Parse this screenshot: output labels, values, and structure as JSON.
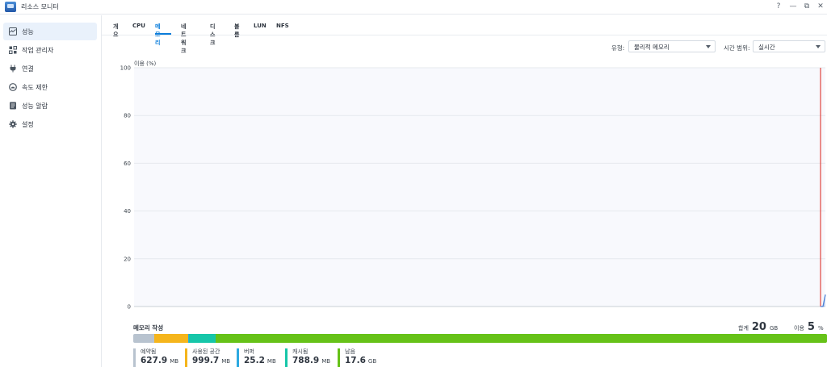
{
  "window": {
    "title": "리소스 모니터",
    "controls": {
      "help": "?",
      "minimize": "—",
      "restore": "⧉",
      "close": "✕"
    }
  },
  "sidebar": {
    "items": [
      {
        "label": "성능",
        "icon": "performance-icon",
        "active": true
      },
      {
        "label": "작업 관리자",
        "icon": "task-manager-icon"
      },
      {
        "label": "연결",
        "icon": "plug-icon"
      },
      {
        "label": "속도 제한",
        "icon": "speed-limit-icon"
      },
      {
        "label": "성능 알람",
        "icon": "alarm-icon"
      },
      {
        "label": "설정",
        "icon": "gear-icon"
      }
    ]
  },
  "tabs": [
    {
      "label": "개요"
    },
    {
      "label": "CPU"
    },
    {
      "label": "메모리",
      "active": true
    },
    {
      "label": "네트워크"
    },
    {
      "label": "디스크"
    },
    {
      "label": "볼륨"
    },
    {
      "label": "LUN"
    },
    {
      "label": "NFS"
    }
  ],
  "filters": {
    "type_label": "유형:",
    "type_value": "물리적 메모리",
    "range_label": "시간 범위:",
    "range_value": "실시간"
  },
  "chart_data": {
    "type": "line",
    "ylabel": "이용 (%)",
    "ylim": [
      0,
      100
    ],
    "yticks": [
      "100",
      "80",
      "60",
      "40",
      "20",
      "0"
    ],
    "grid": true,
    "series": [
      {
        "values": [
          0,
          0,
          5
        ],
        "color": "#4a7fd6"
      }
    ],
    "marker_color": "#e0443e"
  },
  "memory": {
    "title": "메모리 작성",
    "total_label": "합계",
    "total_value": "20",
    "total_unit": "GB",
    "usage_label": "이용",
    "usage_value": "5",
    "usage_unit": "%",
    "segments": [
      {
        "label": "예약됨",
        "value": "627.9",
        "unit": "MB",
        "color": "#b8c3cf",
        "fraction": 0.0307
      },
      {
        "label": "사용된 공간",
        "value": "999.7",
        "unit": "MB",
        "color": "#f5b51c",
        "fraction": 0.0488
      },
      {
        "label": "버퍼",
        "value": "25.2",
        "unit": "MB",
        "color": "#2da9e1",
        "fraction": 0.0012
      },
      {
        "label": "캐시됨",
        "value": "788.9",
        "unit": "MB",
        "color": "#16c6a9",
        "fraction": 0.0385
      },
      {
        "label": "남음",
        "value": "17.6",
        "unit": "GB",
        "color": "#66c218",
        "fraction": 0.8808
      }
    ]
  }
}
